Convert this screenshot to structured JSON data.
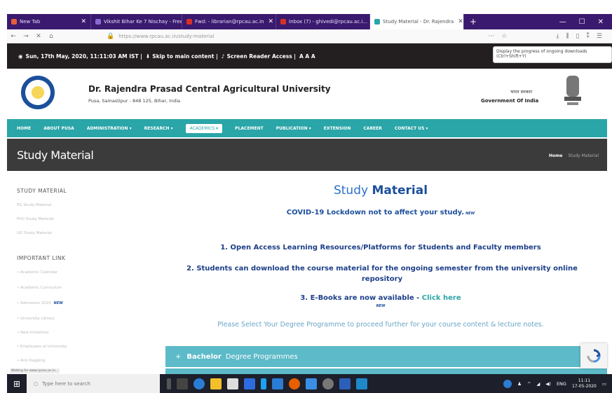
{
  "browser": {
    "tabs": [
      {
        "label": "New Tab",
        "color": "#e85d3a"
      },
      {
        "label": "Vikshit Bihar Ke 7 Nischay - Free I...",
        "color": "#3a1a6e"
      },
      {
        "label": "Fwd: - librarian@rpcau.ac.in",
        "color": "#d93025"
      },
      {
        "label": "Inbox (7) - ghivedi@rpcau.ac.i...",
        "color": "#d93025"
      },
      {
        "label": "Study Material - Dr. Rajendra",
        "color": "#2aa5a8"
      }
    ],
    "new_tab": "+",
    "url": "https://www.rpcau.ac.in/study-material",
    "download_tooltip": "Display the progress of ongoing downloads (Ctrl+Shift+Y)"
  },
  "infobar": {
    "datetime": "Sun, 17th May, 2020, 11:11:03 AM IST |",
    "skip": "Skip to main content |",
    "reader": "Screen Reader Access |",
    "textsize": "A A A"
  },
  "header": {
    "name": "Dr. Rajendra Prasad Central Agricultural University",
    "address": "Pusa, Samastipur - 848 125, Bihar, India",
    "gov_hindi": "भारत सरकार",
    "gov": "Government Of India"
  },
  "nav": [
    "HOME",
    "ABOUT PUSA",
    "ADMINISTRATION ▾",
    "RESEARCH ▾",
    "ACADEMICS ▾",
    "PLACEMENT",
    "PUBLICATION ▾",
    "EXTENSION",
    "CAREER",
    "CONTACT US ▾"
  ],
  "page": {
    "title": "Study Material",
    "crumb_home": "Home",
    "crumb_current": "Study Material"
  },
  "sidebar": {
    "head1": "STUDY MATERIAL",
    "links1": [
      "PG Study Material",
      "PhD Study Material",
      "UG Study Material"
    ],
    "head2": "IMPORTANT LINK",
    "links2": [
      "• Academic Calendar",
      "• Academic Curriculum",
      "• Admission 2020",
      "• University Library",
      "• New Initiatives",
      "• Employees of University",
      "• Anti Ragging"
    ]
  },
  "content": {
    "title_a": "Study ",
    "title_b": "Material",
    "covid": "COVID-19 Lockdown not to affect your study.",
    "new_badge": "NEW",
    "l1": "1. Open Access Learning Resources/Platforms for Students and Faculty members",
    "l2": "2. Students can download the course material for the ongoing semester from the university online repository",
    "l3": "3. E-Books  are now available -",
    "l3_link": "Click here",
    "select": "Please Select Your Degree Programme to proceed further for your course content & lecture notes.",
    "accordion_plus": "+",
    "accordion_bold": "Bachelor",
    "accordion_rest": "Degree Programmes"
  },
  "status_url": "Waiting for www.rpcau.ac.in...",
  "taskbar": {
    "search": "Type here to search",
    "lang": "ENG",
    "time": "11:11",
    "date": "17-05-2020"
  }
}
